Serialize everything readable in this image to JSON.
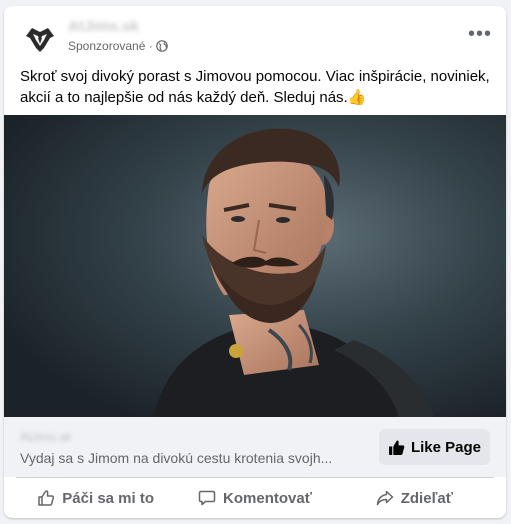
{
  "post": {
    "page_name": "AtJims.sk",
    "sponsored_label": "Sponzorované ·",
    "text": "Skroť svoj divoký porast s Jimovou pomocou. Viac inšpirácie, noviniek, akcií a to najlepšie od nás každý deň. Sleduj nás.👍",
    "more_label": "•••"
  },
  "link": {
    "domain": "AtJims.sk",
    "description": "Vydaj sa s Jimom na divokú cestu krotenia svojh...",
    "button_label": "Like Page"
  },
  "actions": {
    "like": "Páči sa mi to",
    "comment": "Komentovať",
    "share": "Zdieľať"
  },
  "colors": {
    "text_secondary": "#65676b",
    "button_bg": "#e4e6eb",
    "card_bg": "#ffffff",
    "page_bg": "#f0f2f5"
  },
  "icons": [
    "brand-logo",
    "globe-icon",
    "more-options-icon",
    "thumbs-up-icon",
    "comment-icon",
    "share-icon"
  ]
}
